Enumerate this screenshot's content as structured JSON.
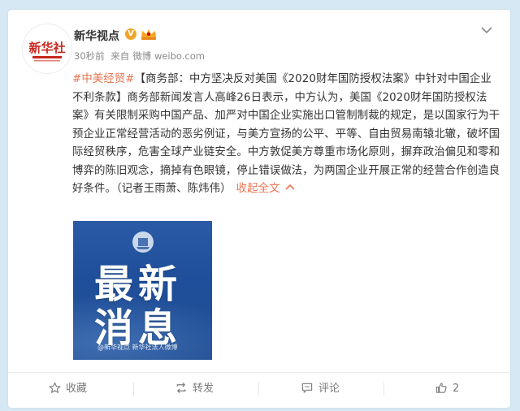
{
  "post": {
    "author": "新华视点",
    "avatar_text": "新华社",
    "time": "30秒前",
    "source_prefix": "来自",
    "source": "微博 weibo.com",
    "topic": "#中美经贸#",
    "body": "【商务部：中方坚决反对美国《2020财年国防授权法案》中针对中国企业不利条款】商务部新闻发言人高峰26日表示，中方认为，美国《2020财年国防授权法案》有关限制采购中国产品、加严对中国企业实施出口管制制裁的规定，是以国家行为干预企业正常经营活动的恶劣例证，与美方宣扬的公平、平等、自由贸易南辕北辙，破坏国际经贸秩序，危害全球产业链安全。中方敦促美方尊重市场化原则，摒弃政治偏见和零和博弈的陈旧观念，摘掉有色眼镜，停止错误做法，为两国企业开展正常的经营合作创造良好条件。（记者王雨萧、陈炜伟）",
    "collapse_label": "收起全文"
  },
  "image": {
    "line1": "最新",
    "line2": "消息",
    "watermark": "@新华视点  新华社法人微博"
  },
  "actions": {
    "favorite": "收藏",
    "repost": "转发",
    "comment": "评论",
    "like_count": "2"
  },
  "colors": {
    "accent": "#eb7350",
    "background": "#d5e8f4",
    "verified": "#f0a52b"
  }
}
